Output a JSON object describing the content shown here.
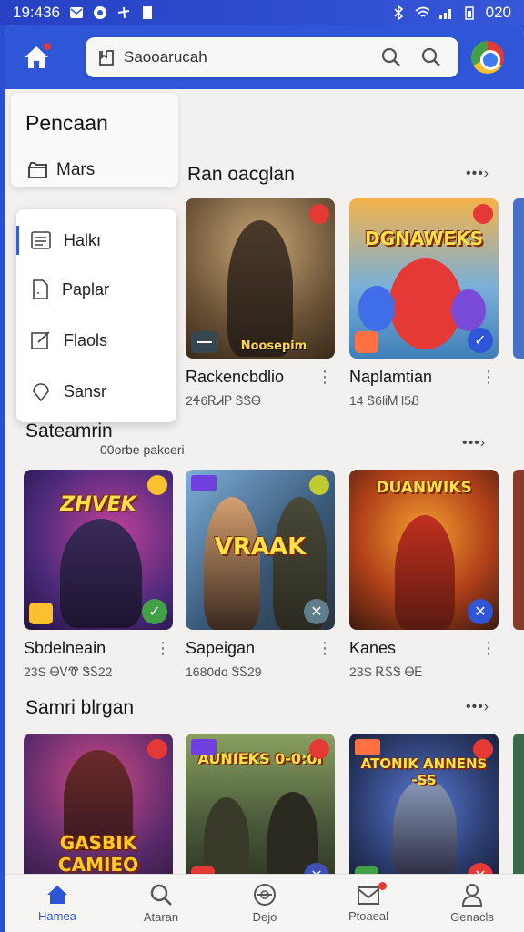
{
  "status_bar": {
    "time": "19:436",
    "battery": "020"
  },
  "header": {
    "search_label": "Saooarucah"
  },
  "side_panel": {
    "title": "Pencaan",
    "mars_label": "Mars"
  },
  "dropdown": {
    "items": [
      {
        "label": "Halkı",
        "icon": "document-icon"
      },
      {
        "label": "Paplar",
        "icon": "file-icon"
      },
      {
        "label": "Flaols",
        "icon": "edit-icon"
      },
      {
        "label": "Sansr",
        "icon": "pin-icon"
      }
    ]
  },
  "sections": [
    {
      "title": "Ran oacglan",
      "more": "•••›",
      "cards": [
        {
          "name": "Rackencbdlio",
          "meta": "2Ꮞ6ᎡᏗᏢ ᏕᏕᎾ",
          "art_title": "Noosepim",
          "accent": "#7a5a3a"
        },
        {
          "name": "Naplamtian",
          "meta": "14 Ꮥ6lᎥᎷ l5Ᏸ",
          "art_title": "DGNAWEKS",
          "accent": "#e04a3a"
        }
      ]
    },
    {
      "title": "Sateamrin",
      "subtitle": "00orbe pakceri",
      "more": "•••›",
      "cards": [
        {
          "name": "Sbdelneain",
          "meta": "23S ᎾᏙᏡ ᏕᏚ22",
          "art_title": "ZHVEK",
          "accent": "#7a3bb0"
        },
        {
          "name": "Sapeigan",
          "meta": "1680do ᏕᏚ29",
          "art_title": "VRAAK",
          "accent": "#3a5a7a"
        },
        {
          "name": "Kanes",
          "meta": "23S ᎡᏚᏕ ᎾᎬ",
          "art_title": "DUANWIKS",
          "accent": "#c0401f"
        }
      ]
    },
    {
      "title": "Samri blrgan",
      "more": "•••›",
      "cards": [
        {
          "name": "",
          "meta": "",
          "art_title": "GASBIK CAMIEO",
          "accent": "#8a2a5a"
        },
        {
          "name": "",
          "meta": "",
          "art_title": "AUNIEKS 0-0:0I",
          "accent": "#4a5a3a"
        },
        {
          "name": "",
          "meta": "",
          "art_title": "ATONIK ANNENS -SS",
          "accent": "#2a3a6a"
        }
      ]
    }
  ],
  "bottom_nav": [
    {
      "label": "Hamea",
      "icon": "home-icon",
      "active": true
    },
    {
      "label": "Ataran",
      "icon": "search-icon",
      "active": false
    },
    {
      "label": "Dejo",
      "icon": "disc-icon",
      "active": false
    },
    {
      "label": "Ptoaeal",
      "icon": "inbox-icon",
      "active": false
    },
    {
      "label": "Genacls",
      "icon": "profile-icon",
      "active": false
    }
  ],
  "colors": {
    "primary": "#2f56d6",
    "background": "#f3f1ef",
    "accent_red": "#e53935"
  }
}
